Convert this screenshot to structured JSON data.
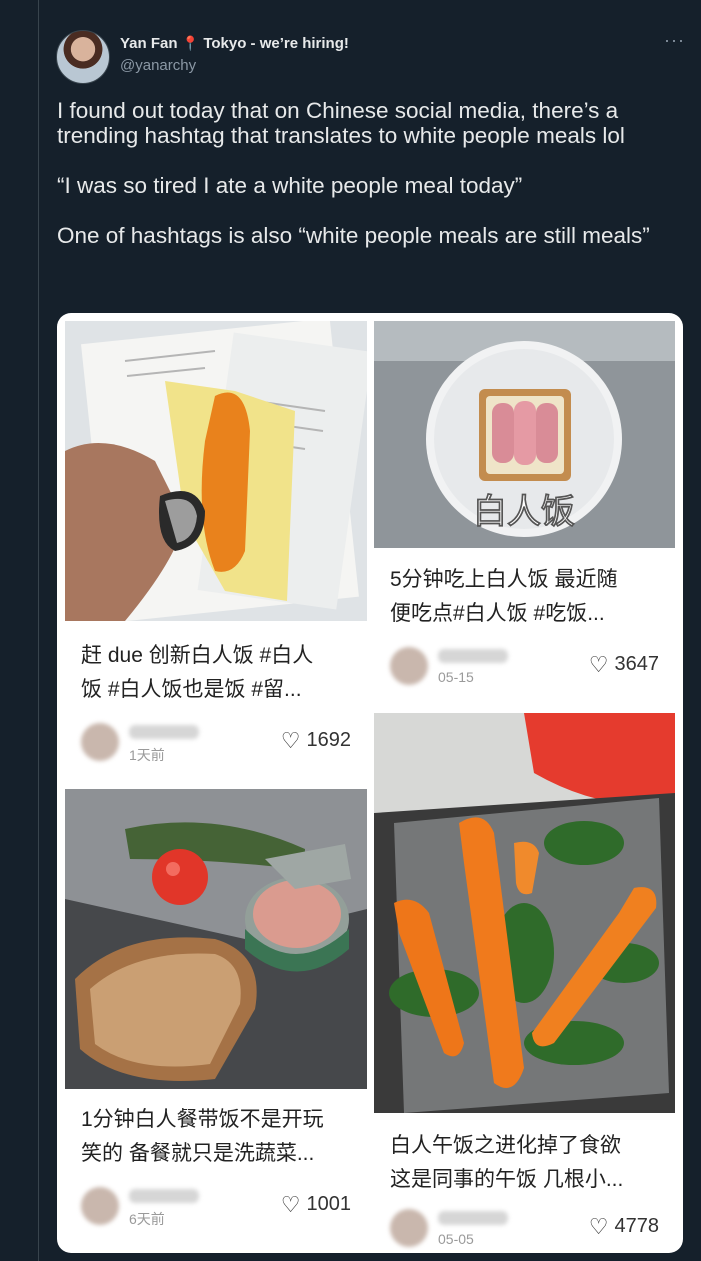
{
  "author": {
    "name": "Yan Fan",
    "pin_icon": "pin-icon",
    "tagline": "Tokyo - we’re hiring!",
    "handle": "@yanarchy"
  },
  "more_label": "···",
  "tweet": {
    "paragraphs": [
      "I found out today that on Chinese social media, there’s a trending hashtag that translates to white people meals lol",
      "“I was so tired I ate a white people meal today”",
      "One of hashtags is also “white people meals are still meals”"
    ]
  },
  "posts": [
    {
      "caption_1": "赶 due 创新白人饭 #白人",
      "caption_2": "饭 #白人饭也是饭 #留...",
      "date": "1天前",
      "likes": "1692"
    },
    {
      "caption_1": "1分钟白人餐带饭不是开玩",
      "caption_2": "笑的 备餐就只是洗蔬菜...",
      "date": "6天前",
      "likes": "1001"
    },
    {
      "overlay": "白人饭",
      "caption_1": "5分钟吃上白人饭 最近随",
      "caption_2": "便吃点#白人饭 #吃饭...",
      "date": "05-15",
      "likes": "3647"
    },
    {
      "caption_1": "白人午饭之进化掉了食欲",
      "caption_2": "这是同事的午饭 几根小...",
      "date": "05-05",
      "likes": "4778"
    }
  ]
}
